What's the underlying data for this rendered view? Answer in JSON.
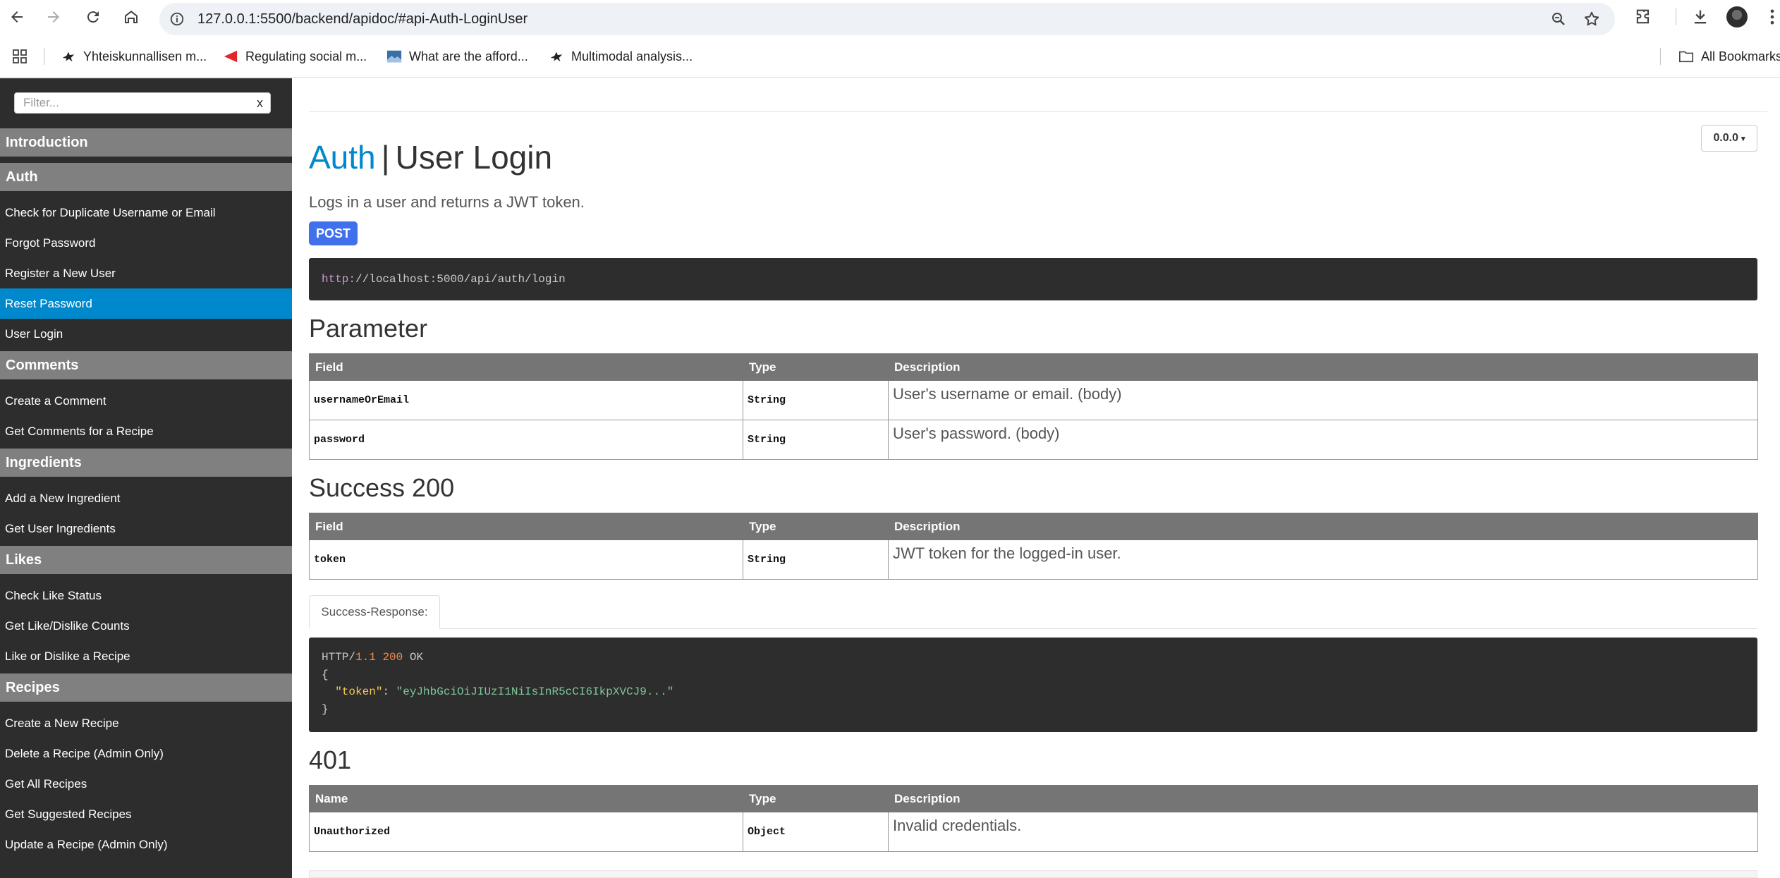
{
  "browser": {
    "url": "127.0.0.1:5500/backend/apidoc/#api-Auth-LoginUser",
    "bookmarks": [
      {
        "label": "Yhteiskunnallisen m...",
        "icon": "bird-favicon-icon"
      },
      {
        "label": "Regulating social m...",
        "icon": "red-triangle-favicon-icon"
      },
      {
        "label": "What are the afford...",
        "icon": "blue-image-favicon-icon"
      },
      {
        "label": "Multimodal analysis...",
        "icon": "bird-favicon-icon"
      }
    ],
    "all_bookmarks": "All Bookmarks"
  },
  "sidebar": {
    "filter_placeholder": "Filter...",
    "filter_clear": "x",
    "groups": [
      {
        "header": "Introduction",
        "items": []
      },
      {
        "header": "Auth",
        "items": [
          "Check for Duplicate Username or Email",
          "Forgot Password",
          "Register a New User",
          "Reset Password",
          "User Login"
        ]
      },
      {
        "header": "Comments",
        "items": [
          "Create a Comment",
          "Get Comments for a Recipe"
        ]
      },
      {
        "header": "Ingredients",
        "items": [
          "Add a New Ingredient",
          "Get User Ingredients"
        ]
      },
      {
        "header": "Likes",
        "items": [
          "Check Like Status",
          "Get Like/Dislike Counts",
          "Like or Dislike a Recipe"
        ]
      },
      {
        "header": "Recipes",
        "items": [
          "Create a New Recipe",
          "Delete a Recipe (Admin Only)",
          "Get All Recipes",
          "Get Suggested Recipes",
          "Update a Recipe (Admin Only)"
        ]
      }
    ],
    "active_item": "Reset Password"
  },
  "main": {
    "version": "0.0.0",
    "title_group": "Auth",
    "title_separator": "|",
    "title_name": "User Login",
    "description": "Logs in a user and returns a JWT token.",
    "method": "POST",
    "endpoint_protocol": "http:",
    "endpoint_rest": "//localhost:5000/api/auth/login",
    "parameter_heading": "Parameter",
    "parameter_table": {
      "headers": [
        "Field",
        "Type",
        "Description"
      ],
      "rows": [
        [
          "usernameOrEmail",
          "String",
          "User's username or email. (body)"
        ],
        [
          "password",
          "String",
          "User's password. (body)"
        ]
      ]
    },
    "success_heading": "Success 200",
    "success_table": {
      "headers": [
        "Field",
        "Type",
        "Description"
      ],
      "rows": [
        [
          "token",
          "String",
          "JWT token for the logged-in user."
        ]
      ]
    },
    "example_tab": "Success-Response:",
    "example": {
      "status_prefix": "HTTP/",
      "status_version": "1.1",
      "status_code": "200",
      "status_text": "OK",
      "open_brace": "{",
      "key": "\"token\"",
      "colon": ": ",
      "value": "\"eyJhbGciOiJIUzI1NiIsInR5cCI6IkpXVCJ9...\"",
      "close_brace": "}"
    },
    "error_heading": "401",
    "error_table": {
      "headers": [
        "Name",
        "Type",
        "Description"
      ],
      "rows": [
        [
          "Unauthorized",
          "Object",
          "Invalid credentials."
        ]
      ]
    }
  }
}
